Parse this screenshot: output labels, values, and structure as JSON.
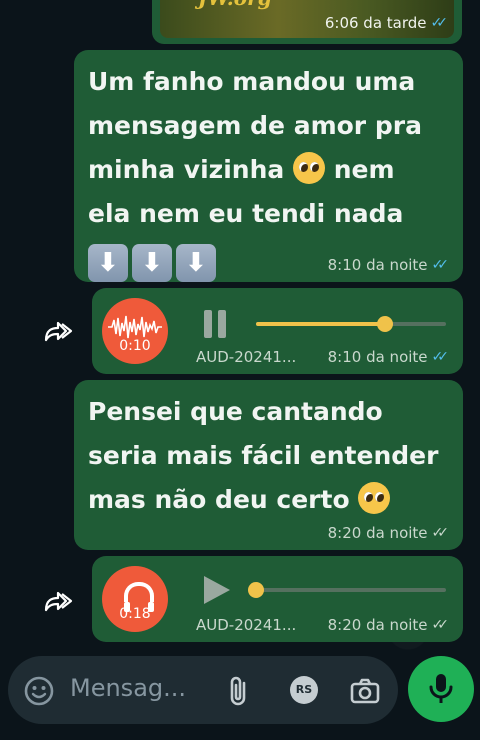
{
  "top_card": {
    "image_text": "JW.org",
    "time": "6:06 da tarde",
    "status": "read"
  },
  "messages": [
    {
      "text_line1": "Um fanho mandou uma",
      "text_line2": "mensagem de amor pra",
      "text_line3_prefix": "minha vizinha",
      "text_line3_suffix": "nem",
      "text_line4": "ela nem eu tendi nada",
      "arrow_glyph": "⬇",
      "time": "8:10 da noite",
      "status": "read"
    },
    {
      "type": "voice",
      "duration": "0:10",
      "state": "playing",
      "progress": 0.68,
      "filename": "AUD-20241...",
      "time": "8:10 da noite",
      "status": "read"
    },
    {
      "text_line1": "Pensei que cantando",
      "text_line2": "seria mais fácil entender",
      "text_line3_prefix": "mas não deu certo",
      "time": "8:20 da noite",
      "status": "delivered"
    },
    {
      "type": "voice",
      "duration": "0:18",
      "state": "paused",
      "progress": 0.0,
      "filename": "AUD-20241...",
      "time": "8:20 da noite",
      "status": "delivered"
    }
  ],
  "composer": {
    "placeholder": "Mensag...",
    "contact_initials": "RS"
  },
  "icons": {
    "emoji": "emoji-icon",
    "attach": "paperclip-icon",
    "camera": "camera-icon",
    "mic": "microphone-icon",
    "forward": "forward-icon"
  },
  "colors": {
    "bubble": "#1f5c36",
    "accent_green": "#1fb056",
    "read_ticks": "#53bdeb",
    "progress": "#f0c24a",
    "voice_avatar": "#ef5a3a"
  }
}
